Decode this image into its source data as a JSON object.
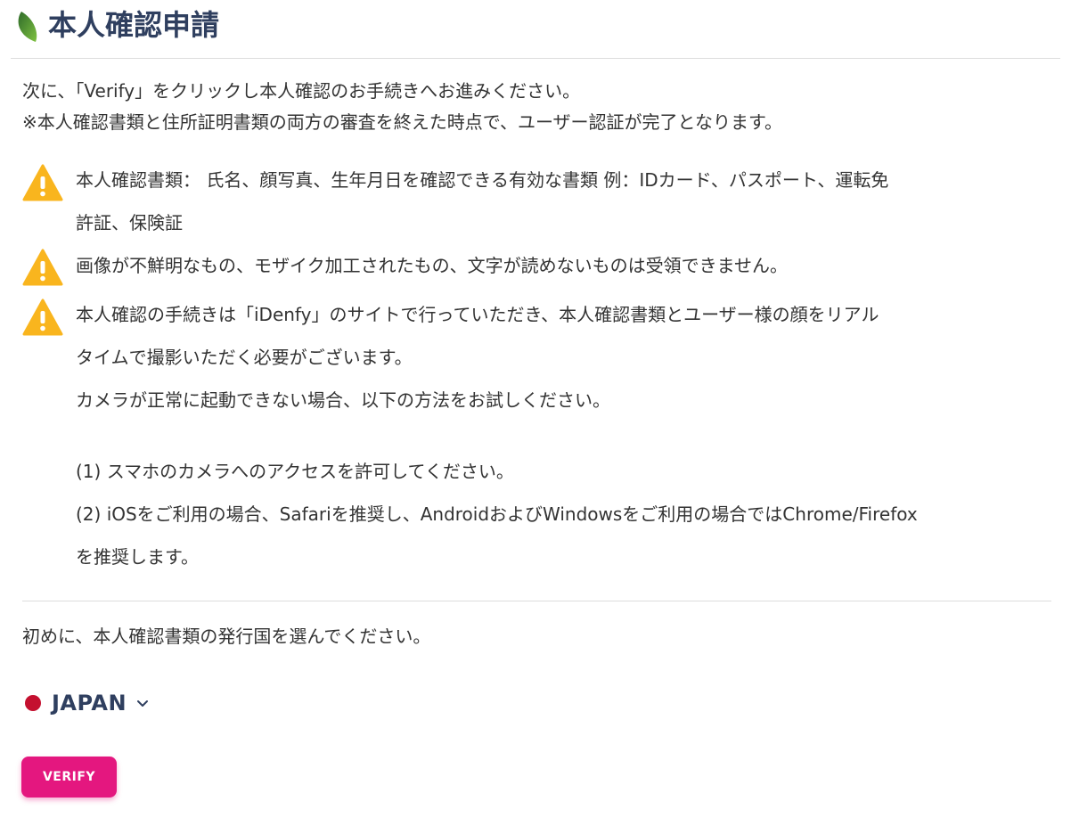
{
  "header": {
    "title": "本人確認申請"
  },
  "intro": {
    "line1": "次に、「Verify」をクリックし本人確認のお手続きへお進みください。",
    "line2": "※本人確認書類と住所証明書類の両方の審査を終えた時点で、ユーザー認証が完了となります。"
  },
  "warnings": [
    {
      "lines": [
        "本人確認書類： 氏名、顔写真、生年月日を確認できる有効な書類 例：IDカード、パスポート、運転免",
        "許証、保険証"
      ]
    },
    {
      "lines": [
        "画像が不鮮明なもの、モザイク加工されたもの、文字が読めないものは受領できません。"
      ]
    },
    {
      "lines": [
        "本人確認の手続きは「iDenfy」のサイトで行っていただき、本人確認書類とユーザー様の顔をリアル",
        "タイムで撮影いただく必要がございます。",
        "カメラが正常に起動できない場合、以下の方法をお試しください。",
        "(1) スマホのカメラへのアクセスを許可してください。",
        "(2) iOSをご利用の場合、Safariを推奨し、AndroidおよびWindowsをご利用の場合ではChrome/Firefox",
        "を推奨します。"
      ]
    }
  ],
  "country": {
    "instruction": "初めに、本人確認書類の発行国を選んでください。",
    "selected": "JAPAN",
    "flag_color": "#c4102f"
  },
  "verify_button": {
    "label": "VERIFY"
  },
  "colors": {
    "accent": "#e4177f",
    "title": "#2f3f5f",
    "warning": "#f9b51e",
    "leaf": "#3c8a2e"
  },
  "icons": {
    "logo": "leaf-icon",
    "warning": "warning-triangle-icon",
    "dropdown": "chevron-down-icon"
  }
}
